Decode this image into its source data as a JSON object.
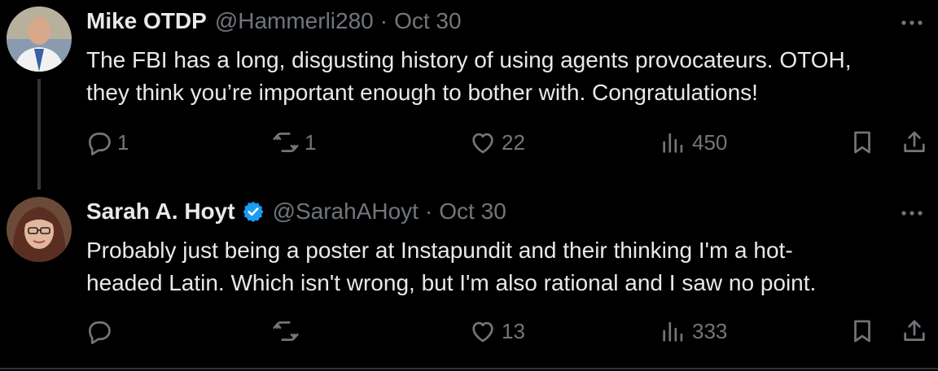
{
  "tweets": [
    {
      "name": "Mike OTDP",
      "handle": "@Hammerli280",
      "date": "Oct 30",
      "text_line1": "The FBI has a long, disgusting history of using agents provocateurs.  OTOH,",
      "text_line2": "they think you’re important enough to bother with.  Congratulations!",
      "replies": "1",
      "reposts": "1",
      "likes": "22",
      "views": "450",
      "verified": false
    },
    {
      "name": "Sarah A. Hoyt",
      "handle": "@SarahAHoyt",
      "date": "Oct 30",
      "text_line1": "Probably just being a poster at Instapundit and their thinking I'm a hot-",
      "text_line2": "headed Latin. Which isn't wrong, but I'm also rational and I saw no point.",
      "replies": "",
      "reposts": "",
      "likes": "13",
      "views": "333",
      "verified": true
    }
  ],
  "separator": "·",
  "icons": [
    "reply-icon",
    "repost-icon",
    "like-icon",
    "views-icon",
    "bookmark-icon",
    "share-icon",
    "more-icon",
    "verified-badge-icon"
  ],
  "colors": {
    "background": "#000000",
    "text": "#e7e9ea",
    "muted": "#71767b",
    "verified": "#1d9bf0"
  }
}
